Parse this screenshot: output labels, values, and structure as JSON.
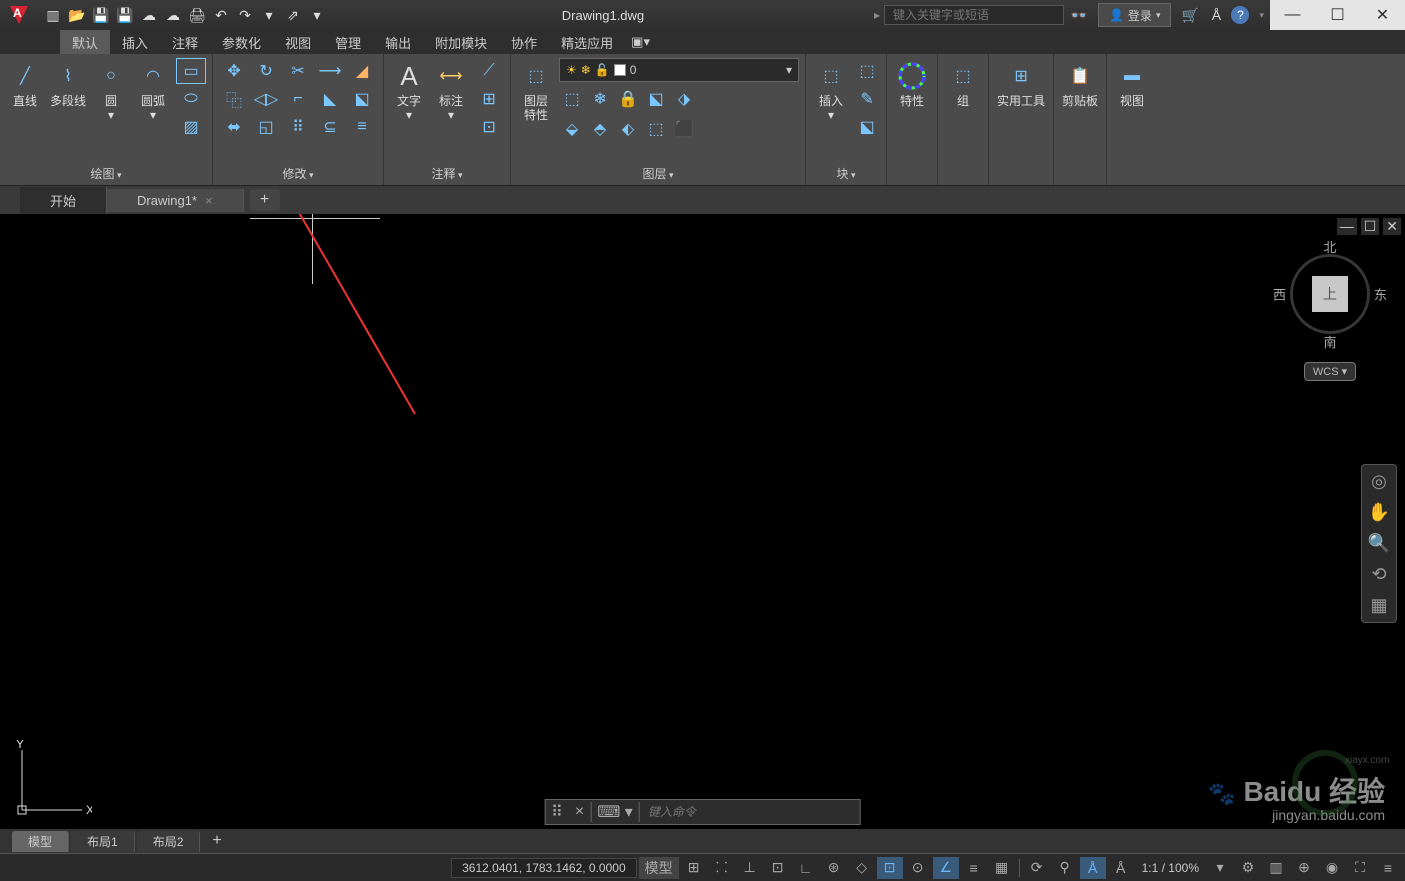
{
  "title": "Drawing1.dwg",
  "search_placeholder": "键入关键字或短语",
  "login_label": "登录",
  "menutabs": [
    "默认",
    "插入",
    "注释",
    "参数化",
    "视图",
    "管理",
    "输出",
    "附加模块",
    "协作",
    "精选应用"
  ],
  "ribbon": {
    "draw": {
      "title": "绘图",
      "line": "直线",
      "pline": "多段线",
      "circle": "圆",
      "arc": "圆弧"
    },
    "modify": {
      "title": "修改"
    },
    "annot": {
      "title": "注释",
      "text": "文字",
      "dim": "标注"
    },
    "layer": {
      "title": "图层",
      "props": "图层\n特性",
      "current": "0"
    },
    "block": {
      "title": "块",
      "insert": "插入"
    },
    "props": {
      "title": "特性"
    },
    "group": {
      "title": "组"
    },
    "util": {
      "title": "实用工具"
    },
    "clip": {
      "title": "剪贴板"
    },
    "view": {
      "title": "视图"
    }
  },
  "filetabs": {
    "start": "开始",
    "drawing": "Drawing1*"
  },
  "viewcube": {
    "n": "北",
    "s": "南",
    "e": "东",
    "w": "西",
    "top": "上",
    "wcs": "WCS"
  },
  "cmd_placeholder": "键入命令",
  "layouts": [
    "模型",
    "布局1",
    "布局2"
  ],
  "status": {
    "coords": "3612.0401, 1783.1462, 0.0000",
    "model": "模型",
    "scale": "1:1 / 100%"
  },
  "watermark": {
    "main": "Baidu 经验",
    "sub": "jingyan.baidu.com",
    "site": "xiayx.com"
  }
}
